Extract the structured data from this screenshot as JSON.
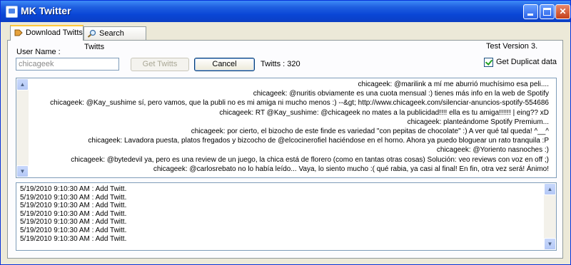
{
  "window": {
    "title": "MK Twitter"
  },
  "tabs": [
    {
      "label": "Download Twitts",
      "active": true
    },
    {
      "label": "Search Twitts",
      "active": false
    }
  ],
  "form": {
    "username_label": "User Name :",
    "username_value": "chicageek",
    "get_button": "Get Twitts",
    "cancel_button": "Cancel",
    "twitts_count": "Twitts : 320",
    "version": "Test Version 3.",
    "duplicate_checkbox_label": "Get Duplicat data",
    "duplicate_checked": true
  },
  "tweets": [
    "chicageek: @marilink a mí me aburrió muchísimo esa peli....",
    "chicageek: @nuritis obviamente es una cuota mensual :) tienes más info en la web de Spotify",
    "chicageek: @Kay_sushime sí, pero vamos, que la publi no es mi amiga ni mucho menos :)  --&gt; http://www.chicageek.com/silenciar-anuncios-spotify-554686",
    "chicageek: RT @Kay_sushime: @chicageek no mates a la publicidad!!!! ella es tu amiga!!!!!! |  eing?? xD",
    "chicageek: planteándome Spotify Premium...",
    "chicageek: por cierto, el bizocho de este finde es variedad \"con pepitas de chocolate\" :)  A ver qué tal queda! ^__^",
    "chicageek: Lavadora puesta, platos fregados y bizcocho de @elcocinerofiel haciéndose en el horno. Ahora ya puedo bloguear un rato tranquila :P",
    "chicageek: @Yoriento nasnoches :)",
    "chicageek: @bytedevil ya, pero es una review de un juego, la chica está de florero (como en tantas otras cosas) Solución: veo reviews con voz en off ;)",
    "chicageek: @carlosrebato no lo había leído... Vaya, lo siento mucho :( qué rabia, ya casi al final! En fin, otra vez será! Ánimo!"
  ],
  "log": [
    "5/19/2010 9:10:30 AM : Add Twitt.",
    "5/19/2010 9:10:30 AM : Add Twitt.",
    "5/19/2010 9:10:30 AM : Add Twitt.",
    "5/19/2010 9:10:30 AM : Add Twitt.",
    "5/19/2010 9:10:30 AM : Add Twitt.",
    "5/19/2010 9:10:30 AM : Add Twitt.",
    "5/19/2010 9:10:30 AM : Add Twitt."
  ],
  "colors": {
    "titlebar": "#0a46d6",
    "window_bg": "#ece9d8",
    "tab_highlight": "#ffc83c"
  }
}
